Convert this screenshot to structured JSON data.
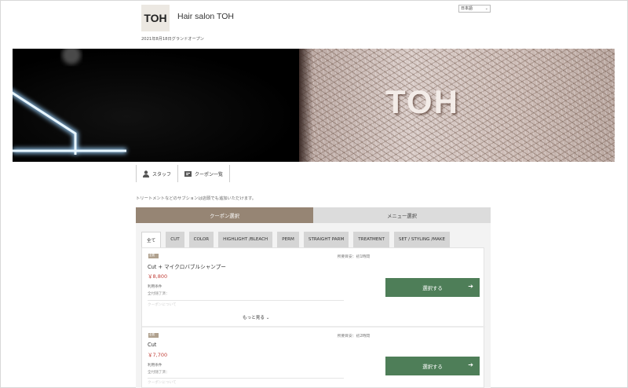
{
  "header": {
    "logo_text": "TOH",
    "salon_name": "Hair salon TOH",
    "language": "日本語",
    "opening_note": "2021年8月18日グランドオープン"
  },
  "hero": {
    "logo_text": "TOH"
  },
  "subnav": {
    "staff_label": "スタッフ",
    "coupons_label": "クーポン一覧"
  },
  "note": "トリートメントなどのサブションは店頭でも追加いただけます。",
  "main_tabs": {
    "coupon_label": "クーポン選択",
    "menu_label": "メニュー選択"
  },
  "categories": [
    "全て",
    "CUT",
    "COLOR",
    "HIGHLIGHT /BLEACH",
    "PERM",
    "STRAIGHT PARM",
    "TREATMENT",
    "SET / STYLING /MAKE"
  ],
  "coupons": [
    {
      "badge": "全員",
      "visit_note": "所要目安：初1時間",
      "title": "Cut + マイクロバブルシャンプー",
      "price": "￥8,800",
      "condition_label": "利用条件",
      "condition_value": "全付随了済：",
      "faded": "クーポンについて",
      "more_label": "もっと見る",
      "select_label": "選択する"
    },
    {
      "badge": "全員",
      "visit_note": "所要目安：初2時間",
      "title": "Cut",
      "price": "￥7,700",
      "condition_label": "利用条件",
      "condition_value": "全付随了済：",
      "faded": "クーポンについて",
      "select_label": "選択する"
    }
  ],
  "colors": {
    "accent_brown": "#968574",
    "select_green": "#4e7e58",
    "price_red": "#c1413a"
  }
}
